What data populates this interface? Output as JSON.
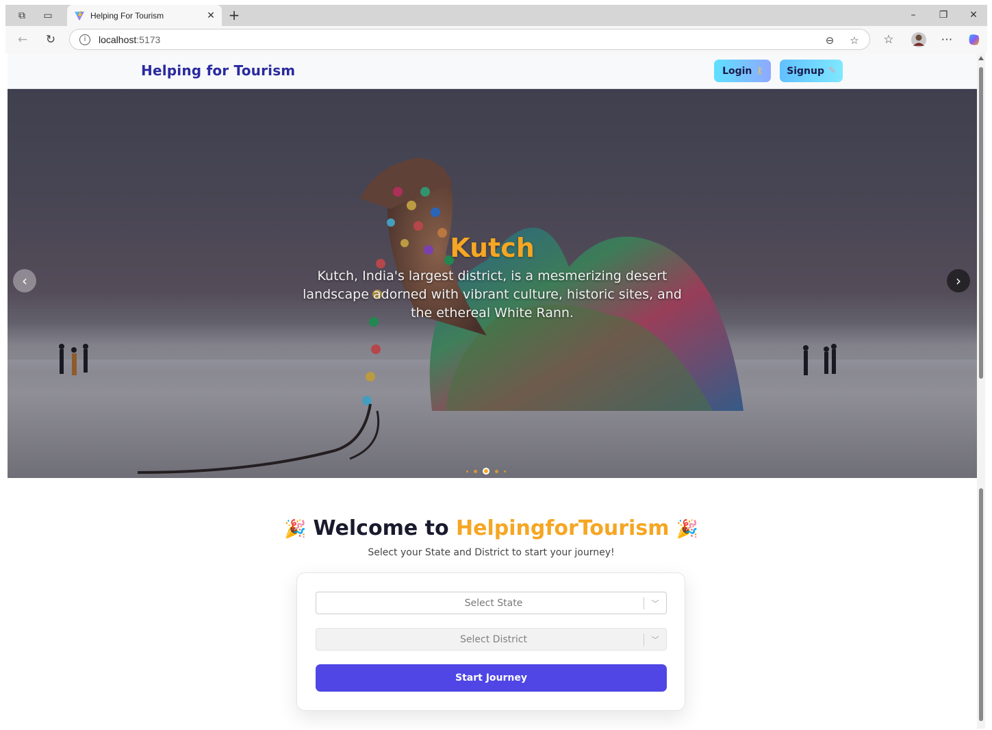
{
  "browser": {
    "tab_title": "Helping For Tourism",
    "url_host": "localhost",
    "url_port": ":5173"
  },
  "header": {
    "brand": "Helping for Tourism",
    "login_label": "Login",
    "signup_label": "Signup"
  },
  "hero": {
    "title": "Kutch",
    "description": "Kutch, India's largest district, is a mesmerizing desert landscape adorned with vibrant culture, historic sites, and the ethereal White Rann.",
    "slide_count": 5,
    "active_slide": 3
  },
  "welcome": {
    "title_prefix": "Welcome to ",
    "title_accent": "HelpingforTourism",
    "subtitle": "Select your State and District to start your journey!"
  },
  "form": {
    "state_placeholder": "Select State",
    "district_placeholder": "Select District",
    "start_label": "Start Journey"
  },
  "colors": {
    "brand": "#2a2aa0",
    "accent": "#f5a623",
    "primary_button": "#4f46e5"
  }
}
